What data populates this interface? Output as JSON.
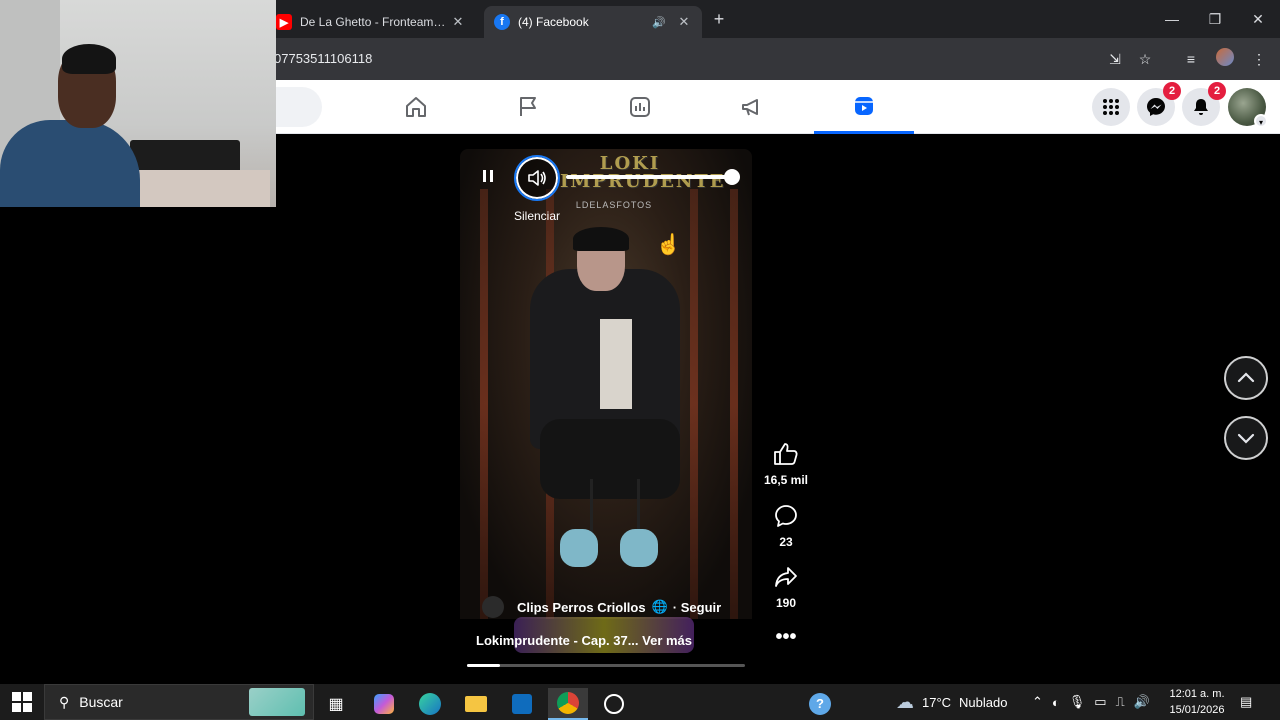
{
  "browser": {
    "tabs": [
      {
        "title": "De La Ghetto - Fronteamos Por",
        "favicon": "youtube-icon",
        "active": false
      },
      {
        "title": "(4) Facebook",
        "favicon": "facebook-icon",
        "active": true
      }
    ],
    "url": "07753511106118"
  },
  "facebook": {
    "nav": [
      "home-icon",
      "pages-flag-icon",
      "dashboard-icon",
      "megaphone-icon",
      "reels-icon"
    ],
    "active_nav": "reels-icon",
    "messenger_badge": "2",
    "notifications_badge": "2",
    "accent": "#0866ff"
  },
  "reel": {
    "logo_line1": "LOKI",
    "logo_line2": "IMPRUDENTE",
    "logo_sub": "LDELASFOTOS",
    "volume_tooltip": "Silenciar",
    "volume_level": 1.0,
    "channel_name": "Clips Perros Criollos",
    "channel_follow": "Seguir",
    "caption": "Lokimprudente - Cap. 37... Ver más",
    "progress": 0.12
  },
  "actions": {
    "likes": "16,5 mil",
    "comments": "23",
    "shares": "190"
  },
  "taskbar": {
    "search_placeholder": "Buscar",
    "weather_temp": "17°C",
    "weather_desc": "Nublado",
    "time": "12:01 a. m.",
    "date": "15/01/2026"
  }
}
